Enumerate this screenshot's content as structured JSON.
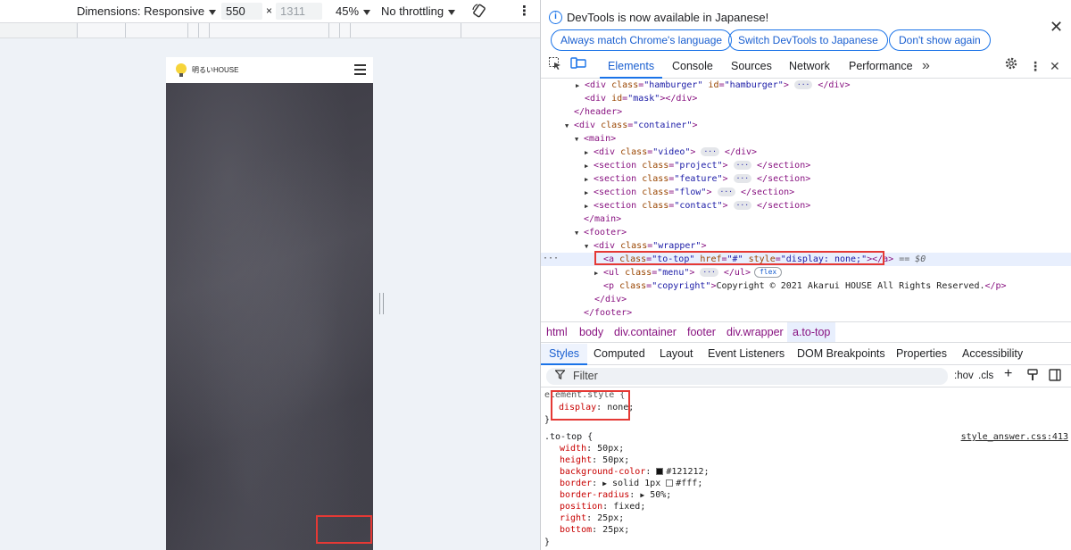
{
  "toolbar": {
    "dimensions_label": "Dimensions: Responsive",
    "width": "550",
    "times": "×",
    "height": "1311",
    "zoom": "45%",
    "throttling": "No throttling"
  },
  "device": {
    "logo_text": "明るいHOUSE"
  },
  "infobar": {
    "message": "DevTools is now available in Japanese!",
    "btn_match": "Always match Chrome's language",
    "btn_switch": "Switch DevTools to Japanese",
    "btn_dont": "Don't show again",
    "close": "✕"
  },
  "tabs": {
    "elements": "Elements",
    "console": "Console",
    "sources": "Sources",
    "network": "Network",
    "performance": "Performance",
    "more": "»"
  },
  "dom": {
    "l1": {
      "t1": "<div ",
      "a1": "class",
      "v1": "\"hamburger\"",
      "a2": "id",
      "v2": "\"hamburger\"",
      "t2": "> ",
      "t3": " </div>"
    },
    "l2": {
      "t1": "<div ",
      "a1": "id",
      "v1": "\"mask\"",
      "t2": "></div>"
    },
    "l3": {
      "t1": "</header>"
    },
    "l4": {
      "t1": "<div ",
      "a1": "class",
      "v1": "\"container\"",
      "t2": ">"
    },
    "l5": {
      "t1": "<main>"
    },
    "l6": {
      "t1": "<div ",
      "a1": "class",
      "v1": "\"video\"",
      "t2": "> ",
      "t3": " </div>"
    },
    "l7": {
      "t1": "<section ",
      "a1": "class",
      "v1": "\"project\"",
      "t2": "> ",
      "t3": " </section>"
    },
    "l8": {
      "t1": "<section ",
      "a1": "class",
      "v1": "\"feature\"",
      "t2": "> ",
      "t3": " </section>"
    },
    "l9": {
      "t1": "<section ",
      "a1": "class",
      "v1": "\"flow\"",
      "t2": "> ",
      "t3": " </section>"
    },
    "l10": {
      "t1": "<section ",
      "a1": "class",
      "v1": "\"contact\"",
      "t2": "> ",
      "t3": " </section>"
    },
    "l11": {
      "t1": "</main>"
    },
    "l12": {
      "t1": "<footer>"
    },
    "l13": {
      "t1": "<div ",
      "a1": "class",
      "v1": "\"wrapper\"",
      "t2": ">"
    },
    "l14": {
      "t1": "<a ",
      "a1": "class",
      "v1": "\"to-top\"",
      "a2": "href",
      "v2": "\"#\"",
      "a3": "style",
      "v3": "\"display: none;\"",
      "t2": "></a>",
      "eq": " == $0"
    },
    "l15": {
      "t1": "<ul ",
      "a1": "class",
      "v1": "\"menu\"",
      "t2": "> ",
      "t3": " </ul>",
      "badge": "flex"
    },
    "l16": {
      "t1": "<p ",
      "a1": "class",
      "v1": "\"copyright\"",
      "t2": ">",
      "text": "Copyright © 2021 Akarui HOUSE All Rights Reserved.",
      "t3": "</p>"
    },
    "l17": {
      "t1": "</div>"
    },
    "l18": {
      "t1": "</footer>"
    },
    "ellipsis": "···",
    "dots": "···"
  },
  "breadcrumbs": [
    "html",
    "body",
    "div.container",
    "footer",
    "div.wrapper",
    "a.to-top"
  ],
  "subtabs": [
    "Styles",
    "Computed",
    "Layout",
    "Event Listeners",
    "DOM Breakpoints",
    "Properties",
    "Accessibility"
  ],
  "filter": {
    "placeholder": "Filter",
    "hov": ":hov",
    "cls": ".cls"
  },
  "styles": {
    "element_selector": "element.style {",
    "element_prop": "display",
    "element_val": "none;",
    "close": "}",
    "rule_selector": ".to-top {",
    "source": "style_answer.css:413",
    "props": [
      {
        "name": "width",
        "value": "50px;"
      },
      {
        "name": "height",
        "value": "50px;"
      },
      {
        "name": "background-color",
        "value": "#121212;",
        "swatch": "#121212"
      },
      {
        "name": "border",
        "value": "solid 1px",
        "value2": "#fff;",
        "swatch": "#ffffff",
        "arrow": "▶"
      },
      {
        "name": "border-radius",
        "value": "50%;",
        "arrow": "▶"
      },
      {
        "name": "position",
        "value": "fixed;"
      },
      {
        "name": "right",
        "value": "25px;"
      },
      {
        "name": "bottom",
        "value": "25px;"
      }
    ]
  },
  "colors": {
    "accent": "#1a73e8",
    "highlight": "#e53935",
    "tag": "#881280",
    "attr": "#994500",
    "value": "#1a1aa6"
  }
}
